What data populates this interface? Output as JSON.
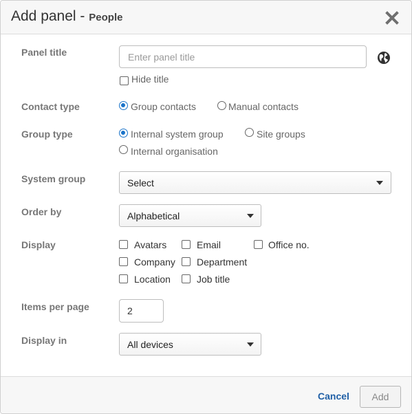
{
  "header": {
    "title": "Add panel -",
    "subtitle": "People",
    "close_icon": "close-x-icon"
  },
  "form": {
    "panel_title": {
      "label": "Panel title",
      "placeholder": "Enter panel title",
      "value": "",
      "hide_title_label": "Hide title",
      "hide_title_checked": false,
      "language_icon": "globe-icon"
    },
    "contact_type": {
      "label": "Contact type",
      "options": [
        {
          "label": "Group contacts",
          "selected": true
        },
        {
          "label": "Manual contacts",
          "selected": false
        }
      ]
    },
    "group_type": {
      "label": "Group type",
      "options": [
        {
          "label": "Internal system group",
          "selected": true
        },
        {
          "label": "Site groups",
          "selected": false
        },
        {
          "label": "Internal organisation",
          "selected": false
        }
      ]
    },
    "system_group": {
      "label": "System group",
      "selected": "Select"
    },
    "order_by": {
      "label": "Order by",
      "selected": "Alphabetical"
    },
    "display": {
      "label": "Display",
      "options": [
        {
          "label": "Avatars",
          "checked": false
        },
        {
          "label": "Email",
          "checked": false
        },
        {
          "label": "Office no.",
          "checked": false
        },
        {
          "label": "Company",
          "checked": false
        },
        {
          "label": "Department",
          "checked": false
        },
        {
          "label": "Location",
          "checked": false
        },
        {
          "label": "Job title",
          "checked": false
        }
      ]
    },
    "items_per_page": {
      "label": "Items per page",
      "value": "2"
    },
    "display_in": {
      "label": "Display in",
      "selected": "All devices"
    }
  },
  "footer": {
    "cancel_label": "Cancel",
    "add_label": "Add"
  },
  "colors": {
    "accent": "#1a73c9",
    "link": "#1f5fa6",
    "label_gray": "#777777",
    "header_bg": "#f7f7f7"
  }
}
